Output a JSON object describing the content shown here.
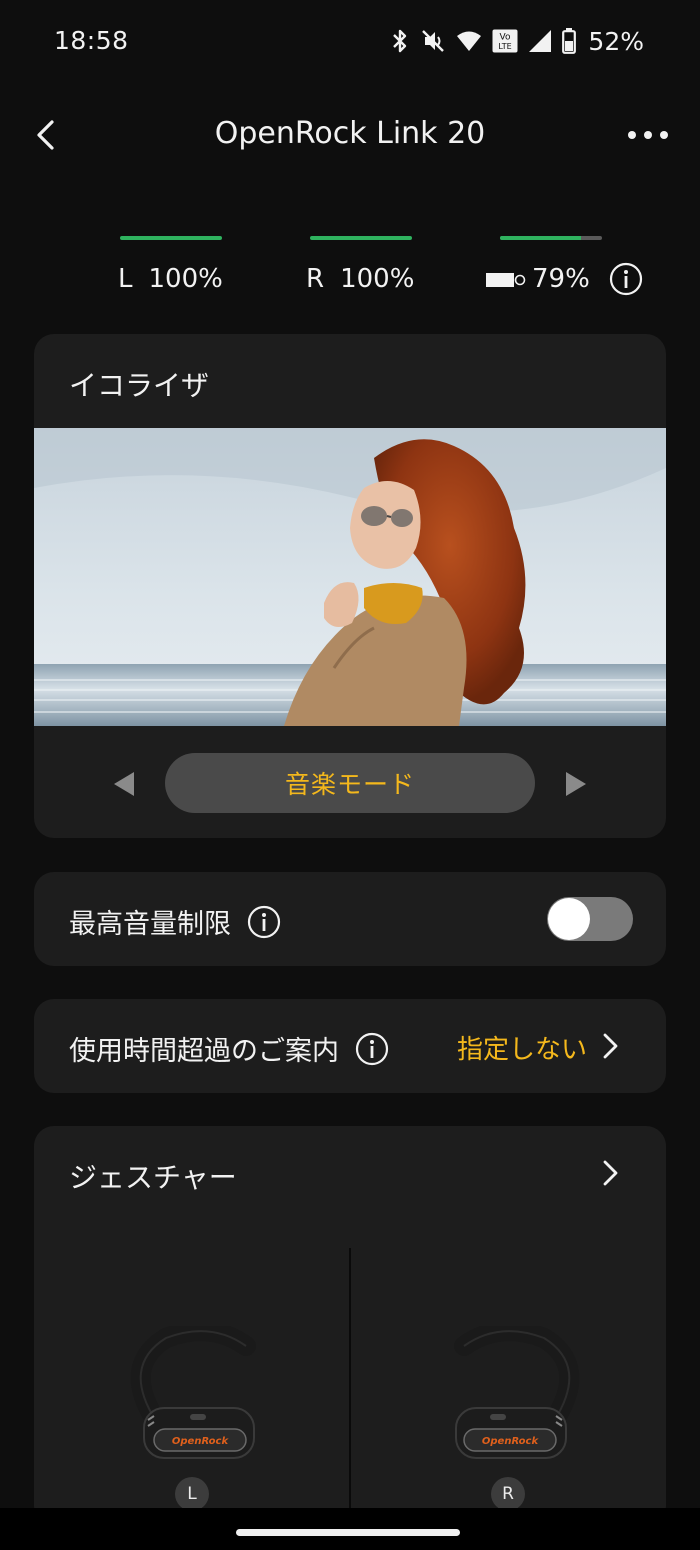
{
  "status": {
    "time": "18:58",
    "battery_percent": "52%",
    "icons": [
      "bluetooth-icon",
      "vibrate-off-icon",
      "wifi-icon",
      "volte-icon",
      "signal-icon",
      "battery-icon"
    ]
  },
  "header": {
    "title": "OpenRock Link 20",
    "back_icon": "chevron-left-icon",
    "more_icon": "more-horizontal-icon"
  },
  "battery": {
    "left": {
      "side": "L",
      "value": "100%",
      "level": 1.0
    },
    "right": {
      "side": "R",
      "value": "100%",
      "level": 1.0
    },
    "case": {
      "value": "79%",
      "level": 0.79
    },
    "fill_color": "#2fb35f"
  },
  "equalizer": {
    "title": "イコライザ",
    "mode": "音楽モード",
    "accent": "#f4b81c"
  },
  "max_volume": {
    "label": "最高音量制限",
    "enabled": false
  },
  "usage_reminder": {
    "label": "使用時間超過のご案内",
    "value": "指定しない"
  },
  "gestures": {
    "title": "ジェスチャー",
    "left_badge": "L",
    "right_badge": "R",
    "brand": "OpenRock"
  }
}
